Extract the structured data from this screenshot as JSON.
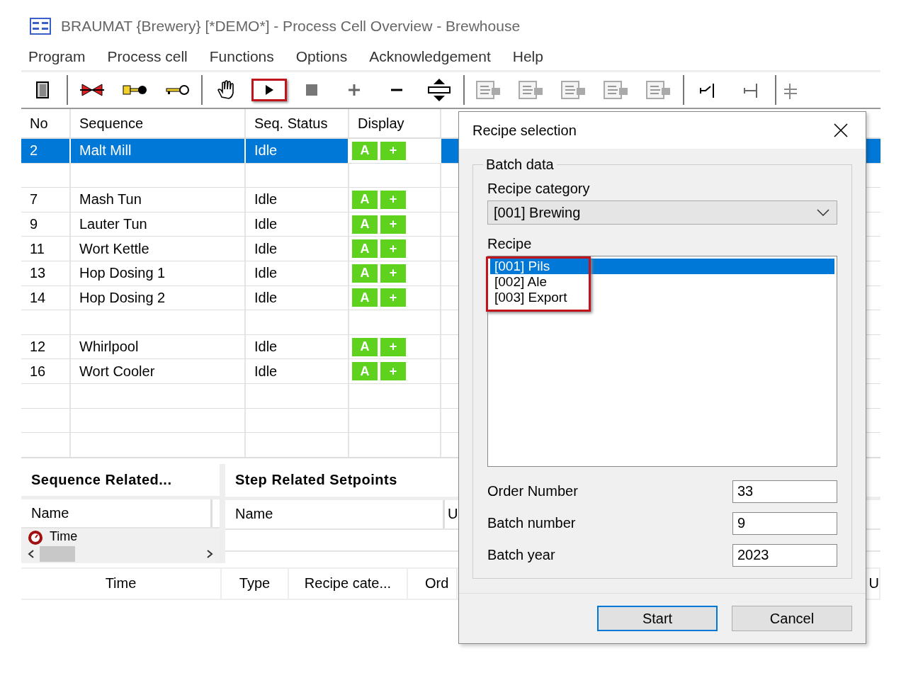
{
  "window": {
    "title": "BRAUMAT {Brewery} [*DEMO*] - Process Cell Overview - Brewhouse"
  },
  "menu": [
    "Program",
    "Process cell",
    "Functions",
    "Options",
    "Acknowledgement",
    "Help"
  ],
  "toolbar": {
    "play_highlighted": true
  },
  "sequences": {
    "columns": [
      "No",
      "Sequence",
      "Seq. Status",
      "Display"
    ],
    "rows": [
      {
        "kind": "sequence",
        "no": "2",
        "name": "Malt Mill",
        "status": "Idle",
        "display": [
          "A",
          "+"
        ],
        "selected": true
      },
      {
        "kind": "blank",
        "selected": false
      },
      {
        "kind": "sequence",
        "no": "7",
        "name": "Mash Tun",
        "status": "Idle",
        "display": [
          "A",
          "+"
        ],
        "selected": false
      },
      {
        "kind": "sequence",
        "no": "9",
        "name": "Lauter Tun",
        "status": "Idle",
        "display": [
          "A",
          "+"
        ],
        "selected": false
      },
      {
        "kind": "sequence",
        "no": "11",
        "name": "Wort Kettle",
        "status": "Idle",
        "display": [
          "A",
          "+"
        ],
        "selected": false
      },
      {
        "kind": "sequence",
        "no": "13",
        "name": "Hop Dosing 1",
        "status": "Idle",
        "display": [
          "A",
          "+"
        ],
        "selected": false
      },
      {
        "kind": "sequence",
        "no": "14",
        "name": "Hop Dosing 2",
        "status": "Idle",
        "display": [
          "A",
          "+"
        ],
        "selected": false
      },
      {
        "kind": "blank",
        "selected": false
      },
      {
        "kind": "sequence",
        "no": "12",
        "name": "Whirlpool",
        "status": "Idle",
        "display": [
          "A",
          "+"
        ],
        "selected": false
      },
      {
        "kind": "sequence",
        "no": "16",
        "name": "Wort Cooler",
        "status": "Idle",
        "display": [
          "A",
          "+"
        ],
        "selected": false
      },
      {
        "kind": "blank",
        "selected": false
      },
      {
        "kind": "blank",
        "selected": false
      },
      {
        "kind": "blank",
        "selected": false
      }
    ]
  },
  "sequence_panel": {
    "title": "Sequence Related...",
    "column": "Name",
    "rows": [
      "Time"
    ]
  },
  "step_panel": {
    "title": "Step Related Setpoints",
    "columns": [
      "Name",
      "U"
    ]
  },
  "log_table": {
    "columns": [
      "Time",
      "Type",
      "Recipe cate...",
      "Ord",
      "U"
    ]
  },
  "dialog": {
    "title": "Recipe selection",
    "group": "Batch data",
    "category_label": "Recipe category",
    "category_value": "[001] Brewing",
    "recipe_label": "Recipe",
    "recipes_highlighted": true,
    "recipes": [
      {
        "name": "[001] Pils",
        "selected": true
      },
      {
        "name": "[002] Ale",
        "selected": false
      },
      {
        "name": "[003] Export",
        "selected": false
      }
    ],
    "fields": [
      {
        "label": "Order Number",
        "value": "33"
      },
      {
        "label": "Batch number",
        "value": "9"
      },
      {
        "label": "Batch year",
        "value": "2023"
      }
    ],
    "buttons": [
      {
        "label": "Start",
        "default": true
      },
      {
        "label": "Cancel",
        "default": false
      }
    ]
  }
}
